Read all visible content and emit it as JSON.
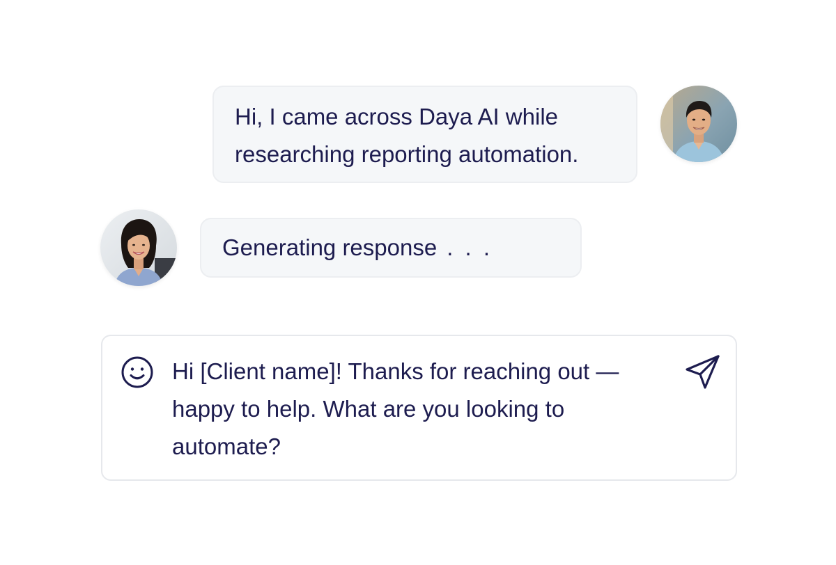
{
  "conversation": {
    "messages": [
      {
        "sender": "client",
        "avatar": "man-avatar",
        "text": "Hi, I came across Daya AI while researching reporting automation."
      },
      {
        "sender": "agent",
        "avatar": "woman-avatar",
        "text": "Generating response",
        "indicator": ". . ."
      }
    ]
  },
  "composer": {
    "draft_text": "Hi [Client name]! Thanks for reaching out — happy to help. What are you looking to automate?",
    "emoji_icon": "smiley-icon",
    "send_icon": "send-icon"
  },
  "colors": {
    "text": "#1d1c4f",
    "bubble_bg": "#f5f7f9",
    "border": "#e6e8ec"
  }
}
